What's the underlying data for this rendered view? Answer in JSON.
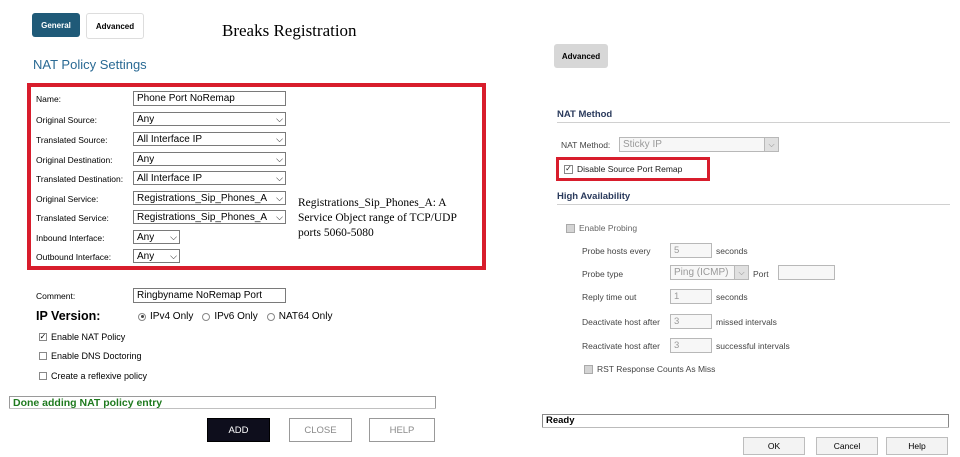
{
  "left": {
    "tabs": {
      "general": "General",
      "advanced": "Advanced"
    },
    "doc_title": "Breaks Registration",
    "section_title": "NAT Policy Settings",
    "fields": {
      "name": {
        "label": "Name:",
        "value": "Phone Port NoRemap"
      },
      "original_source": {
        "label": "Original Source:",
        "value": "Any"
      },
      "translated_source": {
        "label": "Translated Source:",
        "value": "All Interface IP"
      },
      "original_destination": {
        "label": "Original Destination:",
        "value": "Any"
      },
      "translated_destination": {
        "label": "Translated Destination:",
        "value": "All Interface IP"
      },
      "original_service": {
        "label": "Original Service:",
        "value": "Registrations_Sip_Phones_A"
      },
      "translated_service": {
        "label": "Translated Service:",
        "value": "Registrations_Sip_Phones_A"
      },
      "inbound_interface": {
        "label": "Inbound Interface:",
        "value": "Any"
      },
      "outbound_interface": {
        "label": "Outbound Interface:",
        "value": "Any"
      },
      "comment": {
        "label": "Comment:",
        "value": "Ringbyname NoRemap Port"
      }
    },
    "annotation_lines": [
      "Registrations_Sip_Phones_A: A",
      "Service Object range of TCP/UDP",
      "ports 5060-5080"
    ],
    "ip_version": {
      "label": "IP Version:",
      "options": [
        "IPv4 Only",
        "IPv6 Only",
        "NAT64 Only"
      ],
      "selected": "IPv4 Only"
    },
    "checkboxes": {
      "enable_nat_policy": {
        "label": "Enable NAT Policy",
        "checked": true
      },
      "enable_dns_doctoring": {
        "label": "Enable DNS Doctoring",
        "checked": false
      },
      "create_reflexive": {
        "label": "Create a reflexive policy",
        "checked": false
      }
    },
    "status": "Done adding NAT policy entry",
    "buttons": {
      "add": "ADD",
      "close": "CLOSE",
      "help": "HELP"
    }
  },
  "right": {
    "tab": "Advanced",
    "nat_method": {
      "section": "NAT Method",
      "label": "NAT Method:",
      "value": "Sticky IP",
      "disable_source_port_remap": {
        "label": "Disable Source Port Remap",
        "checked": true
      }
    },
    "high_availability": {
      "section": "High Availability",
      "enable_probing": "Enable Probing",
      "probe_hosts_every": {
        "label": "Probe hosts every",
        "value": "5",
        "unit": "seconds"
      },
      "probe_type": {
        "label": "Probe type",
        "value": "Ping (ICMP)",
        "port_label": "Port",
        "port_value": ""
      },
      "reply_time_out": {
        "label": "Reply time out",
        "value": "1",
        "unit": "seconds"
      },
      "deactivate_host_after": {
        "label": "Deactivate host after",
        "value": "3",
        "unit": "missed intervals"
      },
      "reactivate_host_after": {
        "label": "Reactivate host after",
        "value": "3",
        "unit": "successful intervals"
      },
      "rst_response": "RST Response Counts As Miss"
    },
    "status": "Ready",
    "buttons": {
      "ok": "OK",
      "cancel": "Cancel",
      "help": "Help"
    }
  },
  "colors": {
    "accent": "#1f5a78",
    "highlight": "#d81d2c",
    "status_green": "#1f7a1f",
    "section_blue": "#2a6a94"
  }
}
